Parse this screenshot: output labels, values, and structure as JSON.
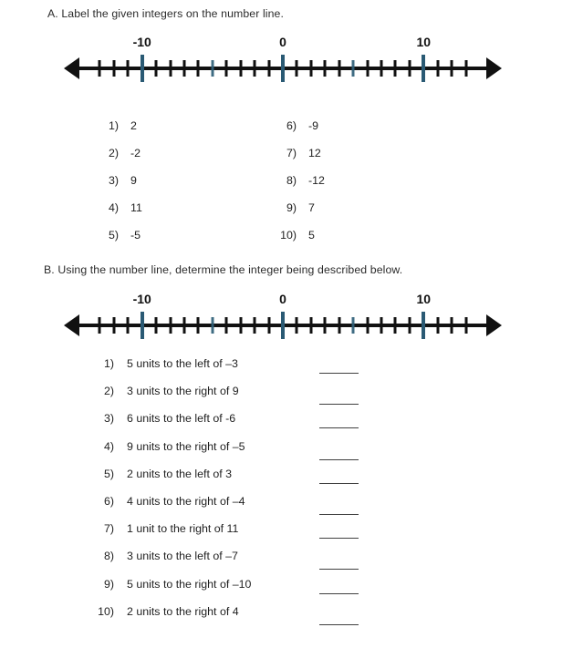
{
  "sections": {
    "a": {
      "heading": "A. Label the given integers on the number line.",
      "items_left": [
        {
          "num": "1)",
          "value": "2"
        },
        {
          "num": "2)",
          "value": "-2"
        },
        {
          "num": "3)",
          "value": "9"
        },
        {
          "num": "4)",
          "value": "11"
        },
        {
          "num": "5)",
          "value": "-5"
        }
      ],
      "items_right": [
        {
          "num": "6)",
          "value": "-9"
        },
        {
          "num": "7)",
          "value": "12"
        },
        {
          "num": "8)",
          "value": "-12"
        },
        {
          "num": "9)",
          "value": "7"
        },
        {
          "num": "10)",
          "value": "5"
        }
      ]
    },
    "b": {
      "heading": "B. Using the number line, determine the integer being described below.",
      "items": [
        {
          "num": "1)",
          "value": "5 units to the left of –3"
        },
        {
          "num": "2)",
          "value": "3 units to the right of 9"
        },
        {
          "num": "3)",
          "value": "6 units to the left of -6"
        },
        {
          "num": "4)",
          "value": "9 units to the right of –5"
        },
        {
          "num": "5)",
          "value": "2 units to the left of 3"
        },
        {
          "num": "6)",
          "value": "4 units to the right of –4"
        },
        {
          "num": "7)",
          "value": "1 unit to the right of 11"
        },
        {
          "num": "8)",
          "value": "3 units to the left of –7"
        },
        {
          "num": "9)",
          "value": "5 units to the right of –10"
        },
        {
          "num": "10)",
          "value": "2 units to the right of 4"
        }
      ]
    }
  },
  "numberline": {
    "labels": [
      {
        "text": "-10",
        "value": -10
      },
      {
        "text": "0",
        "value": 0
      },
      {
        "text": "10",
        "value": 10
      }
    ],
    "min": -14,
    "max": 14,
    "major_ticks": [
      -10,
      0,
      10
    ],
    "accent_ticks": [
      -5,
      5
    ],
    "colors": {
      "line": "#111111",
      "accent": "#2f5f78"
    }
  }
}
